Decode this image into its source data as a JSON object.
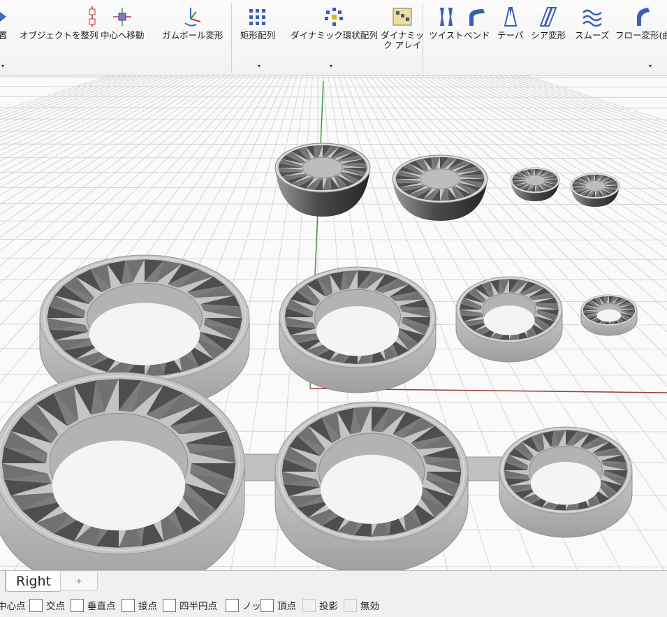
{
  "ribbon": {
    "tools": [
      {
        "label": "置",
        "icon": "arrow-icon"
      },
      {
        "label": "オブジェクトを整列",
        "icon": "align-objects-icon"
      },
      {
        "label": "中心へ移動",
        "icon": "move-to-center-icon"
      },
      {
        "label": "ガムボール変形",
        "icon": "gumball-icon"
      },
      {
        "label": "矩形配列",
        "icon": "rectangular-array-icon"
      },
      {
        "label": "ダイナミック環状配列",
        "icon": "polar-array-icon"
      },
      {
        "label": "ダイナミッ\nク アレイ",
        "icon": "dynamic-array-icon"
      },
      {
        "label": "ツイスト",
        "icon": "twist-icon"
      },
      {
        "label": "ベンド",
        "icon": "bend-icon"
      },
      {
        "label": "テーパ",
        "icon": "taper-icon"
      },
      {
        "label": "シア変形",
        "icon": "shear-icon"
      },
      {
        "label": "スムーズ",
        "icon": "smooth-icon"
      },
      {
        "label": "フロー変形(曲",
        "icon": "flow-icon"
      }
    ]
  },
  "tabs": {
    "active": "Right",
    "add": "+"
  },
  "osnap": [
    {
      "label": "中心点",
      "checked": false
    },
    {
      "label": "交点",
      "checked": false
    },
    {
      "label": "垂直点",
      "checked": false
    },
    {
      "label": "接点",
      "checked": false
    },
    {
      "label": "四半円点",
      "checked": false
    },
    {
      "label": "ノット",
      "checked": false
    },
    {
      "label": "頂点",
      "checked": false
    },
    {
      "label": "投影",
      "checked": false,
      "disabled": true
    },
    {
      "label": "無効",
      "checked": false,
      "disabled": true
    }
  ],
  "colors": {
    "x_axis": "#9a3a3a",
    "y_axis": "#3a9a3a",
    "model": "#b9b9b9",
    "grid": "#d4d4d4"
  }
}
